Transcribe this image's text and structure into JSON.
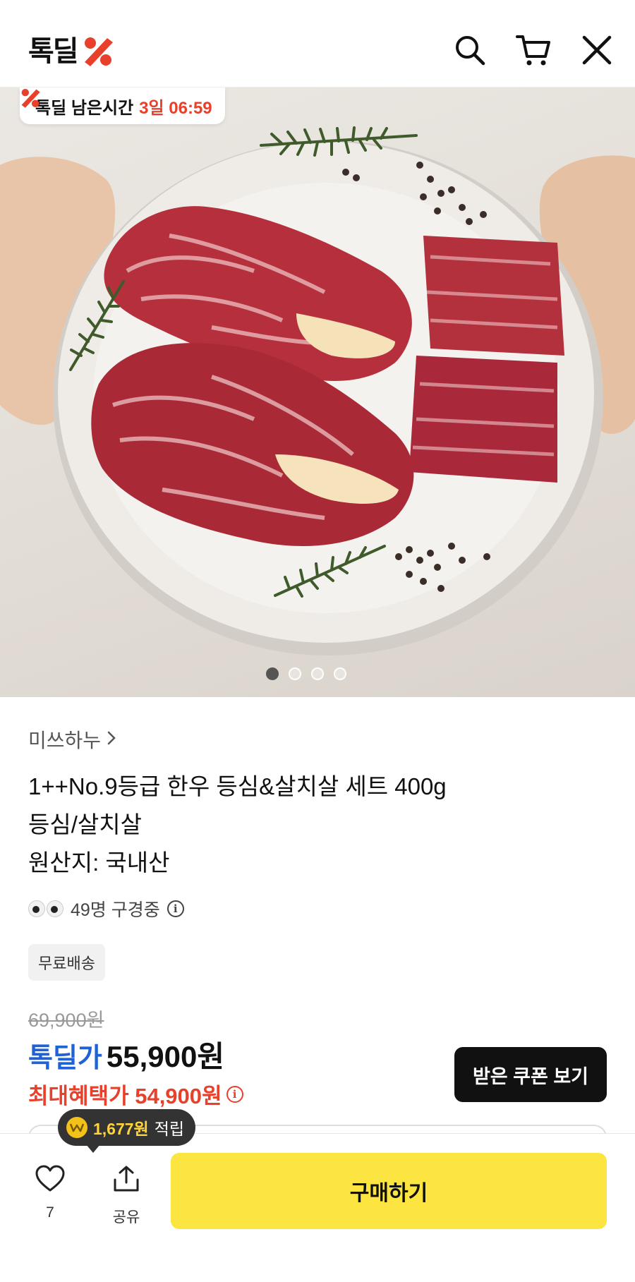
{
  "header": {
    "logo_text": "톡딜",
    "logo_mark": "%",
    "icons": [
      "search-icon",
      "cart-icon",
      "close-icon"
    ]
  },
  "hero": {
    "timer_label": "톡딜 남은시간",
    "timer_value": "3일 06:59",
    "image_count": 4,
    "active_index": 0
  },
  "product": {
    "seller": "미쓰하누",
    "title_lines": [
      "1++No.9등급 한우 등심&살치살 세트 400g",
      "등심/살치살",
      "원산지: 국내산"
    ],
    "viewers": "49명 구경중",
    "badge": "무료배송",
    "original_price": "69,900원",
    "deal_label": "톡딜가",
    "deal_price": "55,900원",
    "max_label": "최대혜택가 54,900원",
    "coupon_button": "받은 쿠폰 보기"
  },
  "bottom_bar": {
    "points_amount": "1,677원",
    "points_text": "적립",
    "like_count": "7",
    "share_label": "공유",
    "buy_button": "구매하기"
  },
  "colors": {
    "accent_blue": "#1e62d6",
    "accent_red": "#e8402a",
    "buy_yellow": "#fde541"
  }
}
